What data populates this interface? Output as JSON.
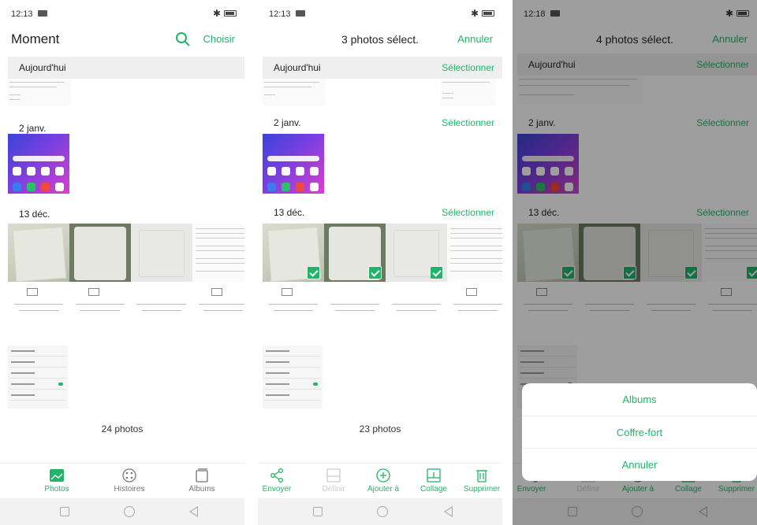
{
  "status_times": [
    "12:13",
    "12:13",
    "12:18"
  ],
  "screen1": {
    "title": "Moment",
    "action": "Choisir",
    "sections": [
      "Aujourd'hui",
      "2 janv.",
      "13 déc."
    ],
    "count": "24 photos",
    "nav": [
      "Photos",
      "Histoires",
      "Albums"
    ]
  },
  "screen2": {
    "title": "3 photos sélect.",
    "action": "Annuler",
    "sections": [
      "Aujourd'hui",
      "2 janv.",
      "13 déc."
    ],
    "select_label": "Sélectionner",
    "count": "23 photos",
    "nav": [
      "Envoyer",
      "Définir",
      "Ajouter à",
      "Collage",
      "Supprimer"
    ]
  },
  "screen3": {
    "title": "4 photos sélect.",
    "action": "Annuler",
    "sections": [
      "Aujourd'hui",
      "2 janv.",
      "13 déc."
    ],
    "select_label": "Sélectionner",
    "nav": [
      "Envoyer",
      "Définir",
      "Ajouter à",
      "Collage",
      "Supprimer"
    ],
    "sheet": [
      "Albums",
      "Coffre-fort",
      "Annuler"
    ]
  },
  "colors": {
    "accent": "#22b56a",
    "header_band": "#efefef"
  },
  "icons": [
    "search-icon",
    "photos-icon",
    "stories-icon",
    "albums-icon",
    "share-icon",
    "set-as-icon",
    "add-to-icon",
    "collage-icon",
    "delete-icon",
    "bluetooth-icon",
    "battery-icon"
  ]
}
